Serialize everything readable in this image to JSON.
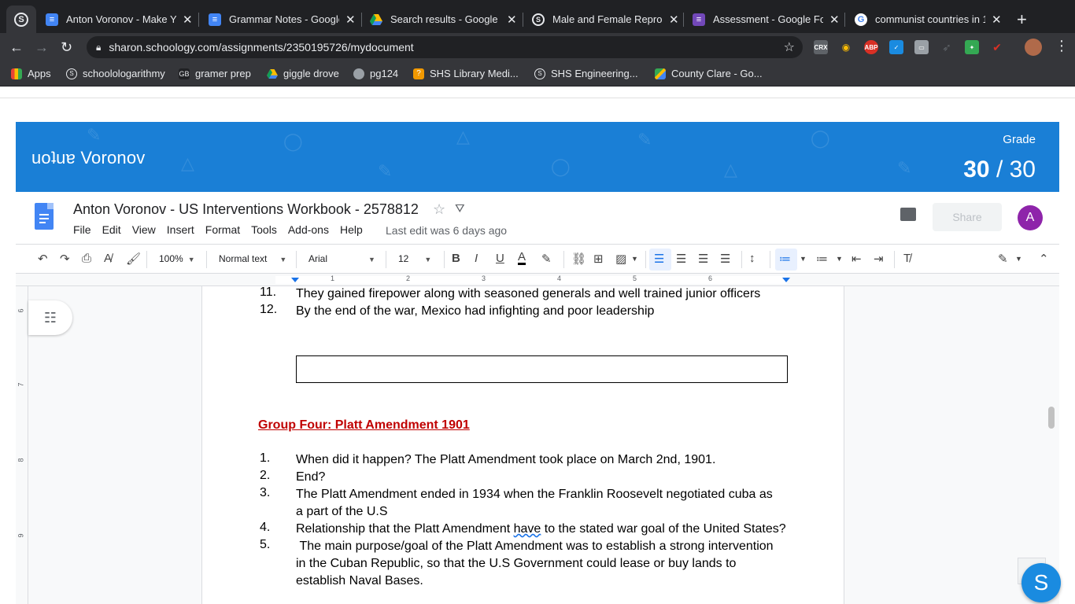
{
  "browser": {
    "tabs": [
      {
        "title": "Anton Voronov - Make Yo",
        "icon_color": "#4285f4"
      },
      {
        "title": "Grammar Notes - Google",
        "icon_color": "#4285f4"
      },
      {
        "title": "Search results - Google D",
        "icon_color": "#fbbc04"
      },
      {
        "title": "Male and Female Reprod",
        "icon_color": "#5f6368"
      },
      {
        "title": "Assessment - Google Fo",
        "icon_color": "#7248b9"
      },
      {
        "title": "communist countries in 1",
        "icon_color": "#ffffff"
      }
    ],
    "url": "sharon.schoology.com/assignments/2350195726/mydocument",
    "bookmarks": [
      {
        "label": "Apps",
        "icon": "apps-grid-icon"
      },
      {
        "label": "schoolologarithmy",
        "icon": "schoology-icon"
      },
      {
        "label": "gramer prep",
        "icon": "gb-icon"
      },
      {
        "label": "giggle drove",
        "icon": "drive-icon"
      },
      {
        "label": "pg124",
        "icon": "globe-icon"
      },
      {
        "label": "SHS Library Medi...",
        "icon": "library-icon"
      },
      {
        "label": "SHS Engineering...",
        "icon": "schoology-icon"
      },
      {
        "label": "County Clare - Go...",
        "icon": "maps-icon"
      }
    ],
    "extensions": [
      "CRX",
      "ABP"
    ]
  },
  "banner": {
    "name": "uoʇuɐ Voronov",
    "grade_label": "Grade",
    "grade_score": "30",
    "grade_sep": " / ",
    "grade_total": "30",
    "color": "#1a7fd6"
  },
  "docs": {
    "title": "Anton Voronov - US Interventions Workbook - 2578812",
    "menu": [
      "File",
      "Edit",
      "View",
      "Insert",
      "Format",
      "Tools",
      "Add-ons",
      "Help"
    ],
    "last_edit": "Last edit was 6 days ago",
    "share_label": "Share",
    "avatar_letter": "A",
    "zoom": "100%",
    "style": "Normal text",
    "font": "Arial",
    "size": "12",
    "ruler_numbers": [
      "1",
      "2",
      "3",
      "4",
      "5",
      "6"
    ],
    "vruler_numbers": [
      "6",
      "7",
      "8",
      "9"
    ]
  },
  "document": {
    "items_top": [
      {
        "num": "11.",
        "text": "They gained firepower along with seasoned generals and well trained junior officers"
      },
      {
        "num": "12.",
        "text": "By the end of the war, Mexico had infighting and poor leadership"
      }
    ],
    "group_heading": "Group Four: Platt Amendment 1901",
    "items": [
      {
        "num": "1.",
        "text": "When did it happen? The Platt Amendment took place on March 2nd, 1901."
      },
      {
        "num": "2.",
        "text": "End?"
      },
      {
        "num": "3.",
        "text": "The Platt Amendment ended in  1934 when the Franklin Roosevelt negotiated cuba as a part of the U.S"
      },
      {
        "num": "4.",
        "text_a": "Relationship that the Platt Amendment ",
        "text_squiggle": "have",
        "text_b": " to the stated war goal of the United States?"
      },
      {
        "num": "5.",
        "text": " The main purpose/goal of the Platt Amendment was to establish a strong intervention in the Cuban Republic, so that the U.S Government could lease or buy lands to establish Naval Bases."
      }
    ]
  },
  "fab_label": "S"
}
